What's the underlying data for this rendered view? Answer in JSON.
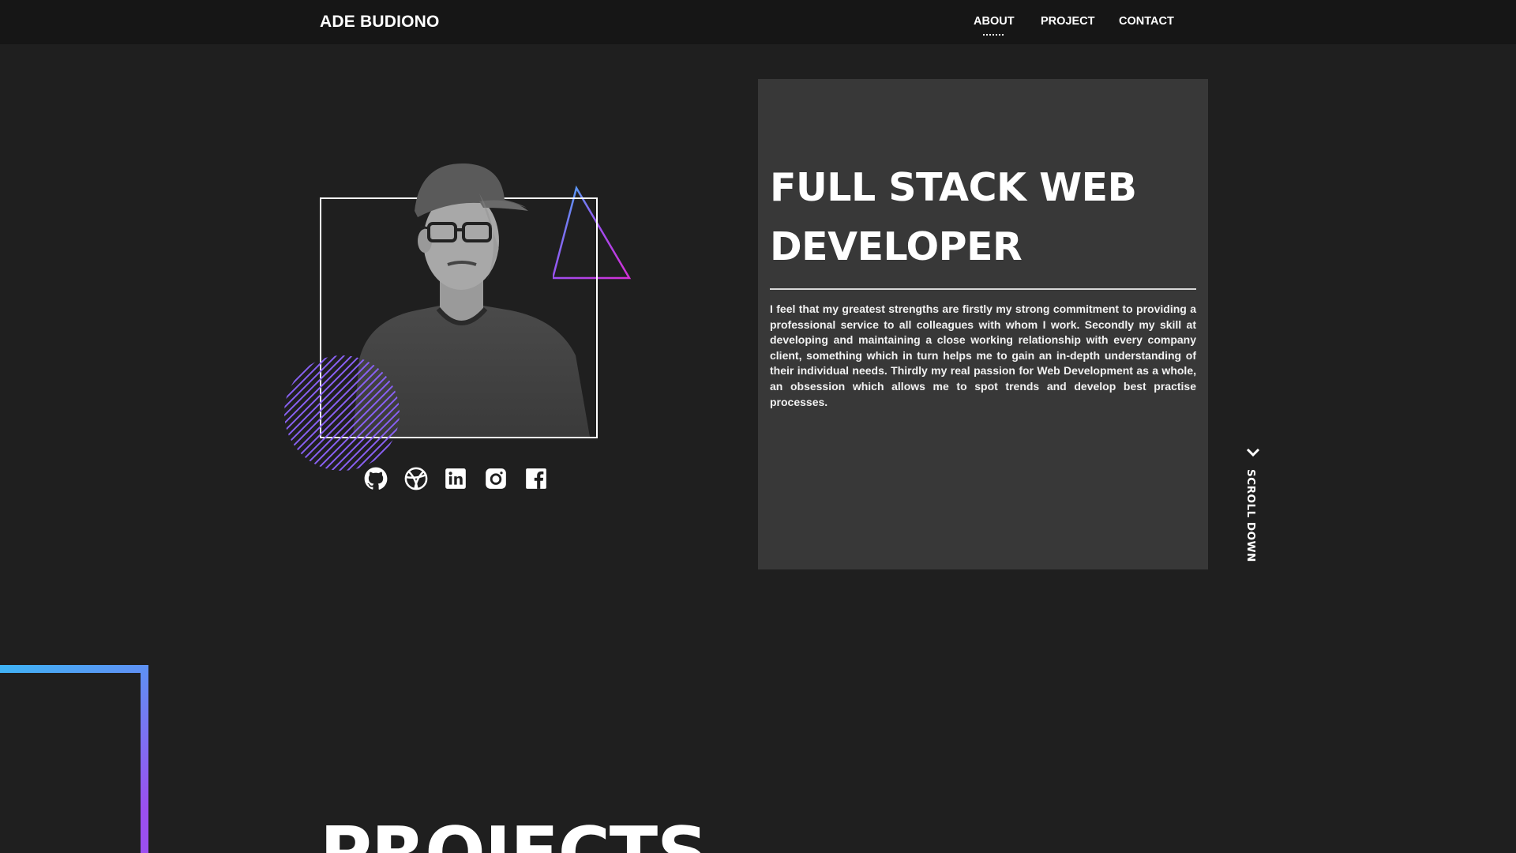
{
  "brand": {
    "name": "ADE BUDIONO"
  },
  "nav": {
    "items": [
      {
        "label": "ABOUT",
        "active": true
      },
      {
        "label": "PROJECT",
        "active": false
      },
      {
        "label": "CONTACT",
        "active": false
      }
    ]
  },
  "profile": {
    "social": [
      {
        "icon": "github-icon"
      },
      {
        "icon": "dribbble-icon"
      },
      {
        "icon": "linkedin-icon"
      },
      {
        "icon": "instagram-icon"
      },
      {
        "icon": "facebook-icon"
      }
    ]
  },
  "about": {
    "headline_line1": "FULL STACK WEB",
    "headline_line2": "DEVELOPER",
    "bio": "I feel that my greatest strengths are firstly my strong commitment to providing a professional service to all colleagues with whom I work. Secondly my skill at developing and maintaining a close working relationship with every company client, something which in turn helps me to gain an in-depth understanding of their individual needs. Thirdly my real passion for Web Development as a whole, an obsession which allows me to spot trends and develop best practise processes."
  },
  "scroll": {
    "label": "SCROLL DOWN",
    "icon": "chevron-down-icon"
  },
  "projects": {
    "title": "PROJECTS"
  },
  "colors": {
    "background": "#1f1f1f",
    "navbar": "#161616",
    "card": "#383838",
    "accent_blue": "#3fb3f5",
    "accent_purple": "#c43df2",
    "accent_magenta": "#d42fd6"
  }
}
